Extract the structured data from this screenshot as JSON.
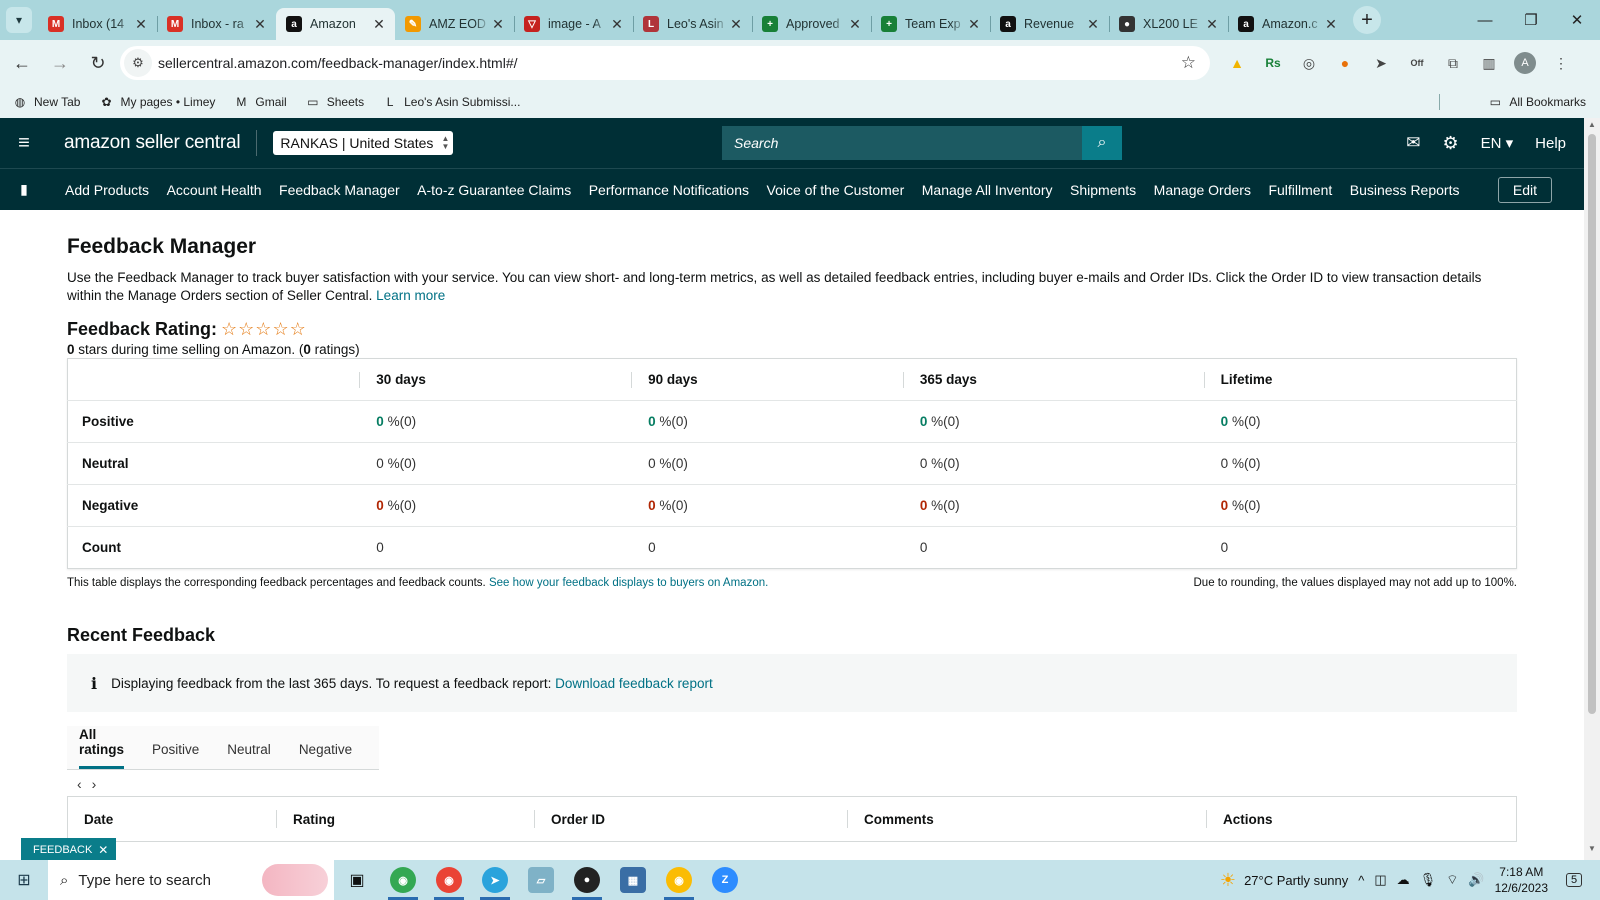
{
  "browser": {
    "tabs": [
      {
        "title": "Inbox (14",
        "icon": "gmail-icon",
        "color": "#d93025",
        "glyph": "M"
      },
      {
        "title": "Inbox - ra",
        "icon": "gmail-icon",
        "color": "#d93025",
        "glyph": "M"
      },
      {
        "title": "Amazon",
        "icon": "amazon-icon",
        "color": "#111111",
        "glyph": "a",
        "active": true
      },
      {
        "title": "AMZ EOD",
        "icon": "pencil-icon",
        "color": "#f29900",
        "glyph": "✎"
      },
      {
        "title": "image - A",
        "icon": "v-logo-icon",
        "color": "#c5221f",
        "glyph": "▽"
      },
      {
        "title": "Leo's Asin",
        "icon": "leos-icon",
        "color": "#b0343a",
        "glyph": "L"
      },
      {
        "title": "Approved",
        "icon": "sheets-icon",
        "color": "#188038",
        "glyph": "+"
      },
      {
        "title": "Team Exp",
        "icon": "sheets-icon",
        "color": "#188038",
        "glyph": "+"
      },
      {
        "title": "Revenue",
        "icon": "amazon-icon",
        "color": "#111111",
        "glyph": "a"
      },
      {
        "title": "XL200 LE",
        "icon": "mag-icon",
        "color": "#333333",
        "glyph": "●"
      },
      {
        "title": "Amazon.c",
        "icon": "amazon-icon",
        "color": "#111111",
        "glyph": "a"
      }
    ],
    "url": "sellercentral.amazon.com/feedback-manager/index.html#/",
    "bookmarks": [
      {
        "label": "New Tab",
        "icon": "globe-icon",
        "glyph": "◍"
      },
      {
        "label": "My pages • Limey",
        "icon": "limey-icon",
        "glyph": "✿"
      },
      {
        "label": "Gmail",
        "icon": "gmail-icon",
        "glyph": "M"
      },
      {
        "label": "Sheets",
        "icon": "folder-icon",
        "glyph": "▭"
      },
      {
        "label": "Leo's Asin Submissi...",
        "icon": "leos-icon",
        "glyph": "L"
      }
    ],
    "all_bookmarks": "All Bookmarks",
    "avatar_letter": "A",
    "extension_badge": "Off"
  },
  "seller_central": {
    "logo_text": "amazon seller central",
    "marketplace": "RANKAS | United States",
    "search_placeholder": "Search",
    "language": "EN",
    "help": "Help",
    "nav_items": [
      "Add Products",
      "Account Health",
      "Feedback Manager",
      "A-to-z Guarantee Claims",
      "Performance Notifications",
      "Voice of the Customer",
      "Manage All Inventory",
      "Shipments",
      "Manage Orders",
      "Fulfillment",
      "Business Reports"
    ],
    "edit_label": "Edit"
  },
  "page": {
    "title": "Feedback Manager",
    "description": "Use the Feedback Manager to track buyer satisfaction with your service. You can view short- and long-term metrics, as well as detailed feedback entries, including buyer e-mails and Order IDs. Click the Order ID to view transaction details within the Manage Orders section of Seller Central.",
    "learn_more": "Learn more",
    "rating_label": "Feedback Rating:",
    "stars": "☆☆☆☆☆",
    "rating_value": "0",
    "rating_sub_text": " stars during time selling on Amazon. (",
    "rating_count": "0",
    "rating_sub_end": " ratings)",
    "metrics": {
      "columns": [
        "30 days",
        "90 days",
        "365 days",
        "Lifetime"
      ],
      "rows": [
        {
          "label": "Positive",
          "kind": "pos",
          "values": [
            {
              "n": "0",
              "p": " %(0)"
            },
            {
              "n": "0",
              "p": " %(0)"
            },
            {
              "n": "0",
              "p": " %(0)"
            },
            {
              "n": "0",
              "p": " %(0)"
            }
          ]
        },
        {
          "label": "Neutral",
          "kind": "neu",
          "values": [
            {
              "n": "0",
              "p": " %(0)"
            },
            {
              "n": "0",
              "p": " %(0)"
            },
            {
              "n": "0",
              "p": " %(0)"
            },
            {
              "n": "0",
              "p": " %(0)"
            }
          ]
        },
        {
          "label": "Negative",
          "kind": "neg",
          "values": [
            {
              "n": "0",
              "p": " %(0)"
            },
            {
              "n": "0",
              "p": " %(0)"
            },
            {
              "n": "0",
              "p": " %(0)"
            },
            {
              "n": "0",
              "p": " %(0)"
            }
          ]
        },
        {
          "label": "Count",
          "kind": "count",
          "values": [
            {
              "n": "0",
              "p": ""
            },
            {
              "n": "0",
              "p": ""
            },
            {
              "n": "0",
              "p": ""
            },
            {
              "n": "0",
              "p": ""
            }
          ]
        }
      ]
    },
    "table_note_left": "This table displays the corresponding feedback percentages and feedback counts.",
    "table_note_link": "See how your feedback displays to buyers on Amazon.",
    "table_note_right": "Due to rounding, the values displayed may not add up to 100%.",
    "recent_title": "Recent Feedback",
    "info_text": "Displaying feedback from the last 365 days. To request a feedback report:",
    "info_link": "Download feedback report",
    "filter_tabs": [
      "All ratings",
      "Positive",
      "Neutral",
      "Negative"
    ],
    "feedback_columns": [
      "Date",
      "Rating",
      "Order ID",
      "Comments",
      "Actions"
    ],
    "feedback_widget": "FEEDBACK",
    "feedback_widget_close": "✕"
  },
  "taskbar": {
    "search_placeholder": "Type here to search",
    "weather": "27°C  Partly sunny",
    "time": "7:18 AM",
    "date": "12/6/2023",
    "notification_count": "5"
  },
  "colors": {
    "header_bg": "#002f36",
    "link": "#007185",
    "positive": "#067d62",
    "negative": "#b12704",
    "browser_frame": "#aad6dc"
  }
}
